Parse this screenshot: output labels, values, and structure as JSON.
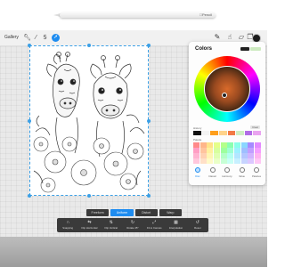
{
  "pencil": {
    "brand": "Pencil"
  },
  "toolbar": {
    "gallery_label": "Gallery",
    "left_icons": [
      "wrench-icon",
      "magic-wand-icon",
      "selection-icon",
      "transform-icon"
    ],
    "right_icons": [
      "brush-icon",
      "smudge-icon",
      "eraser-icon",
      "layers-icon"
    ],
    "current_color": "#1a1a1a"
  },
  "colors_panel": {
    "title": "Colors",
    "current_color": "#222222",
    "previous_color": "#cdeac0",
    "history_label": "History",
    "clear_label": "Clear",
    "history": [
      "#111111",
      "#f4f4f4",
      "#ff9f1c",
      "#ffd38a",
      "#f27a45",
      "#cfeec3",
      "#b16de6",
      "#e9a4f0"
    ],
    "palette_label": "Palette",
    "palette": [
      "#ff8a8a",
      "#ffb68a",
      "#ffe28a",
      "#e5ff8a",
      "#b4ff8a",
      "#8affb0",
      "#8affe8",
      "#8ad6ff",
      "#a58aff",
      "#e38aff",
      "#ff9ec4",
      "#ffc49e",
      "#fff09e",
      "#d7ff9e",
      "#9eff9e",
      "#9effd1",
      "#9ef0ff",
      "#9ebfff",
      "#c19eff",
      "#f59eff",
      "#ffb3d1",
      "#ffd1b3",
      "#fff5b3",
      "#e0ffb3",
      "#b3ffc7",
      "#b3fff0",
      "#b3e6ff",
      "#b3c6ff",
      "#d1b3ff",
      "#ffb3f0",
      "#ffc7dc",
      "#ffe0c7",
      "#fffac7",
      "#eaffc7",
      "#c7ffd6",
      "#c7fff5",
      "#c7f0ff",
      "#c7d4ff",
      "#dcc7ff",
      "#ffc7f5"
    ],
    "tabs": [
      {
        "label": "Disc",
        "icon": "disc-icon"
      },
      {
        "label": "Classic",
        "icon": "classic-icon"
      },
      {
        "label": "Harmony",
        "icon": "harmony-icon"
      },
      {
        "label": "Value",
        "icon": "value-icon"
      },
      {
        "label": "Palettes",
        "icon": "palettes-icon"
      }
    ]
  },
  "transform": {
    "modes": [
      {
        "label": "Freeform"
      },
      {
        "label": "Uniform"
      },
      {
        "label": "Distort"
      },
      {
        "label": "Warp"
      }
    ],
    "actions": [
      {
        "label": "Snapping",
        "icon": "magnet-icon"
      },
      {
        "label": "Flip Horizontal",
        "icon": "flip-horizontal-icon"
      },
      {
        "label": "Flip Vertical",
        "icon": "flip-vertical-icon"
      },
      {
        "label": "Rotate 45°",
        "icon": "rotate-icon"
      },
      {
        "label": "Fit to Canvas",
        "icon": "fit-canvas-icon"
      },
      {
        "label": "Interpolation",
        "icon": "interpolation-icon"
      },
      {
        "label": "Reset",
        "icon": "reset-icon"
      }
    ]
  }
}
